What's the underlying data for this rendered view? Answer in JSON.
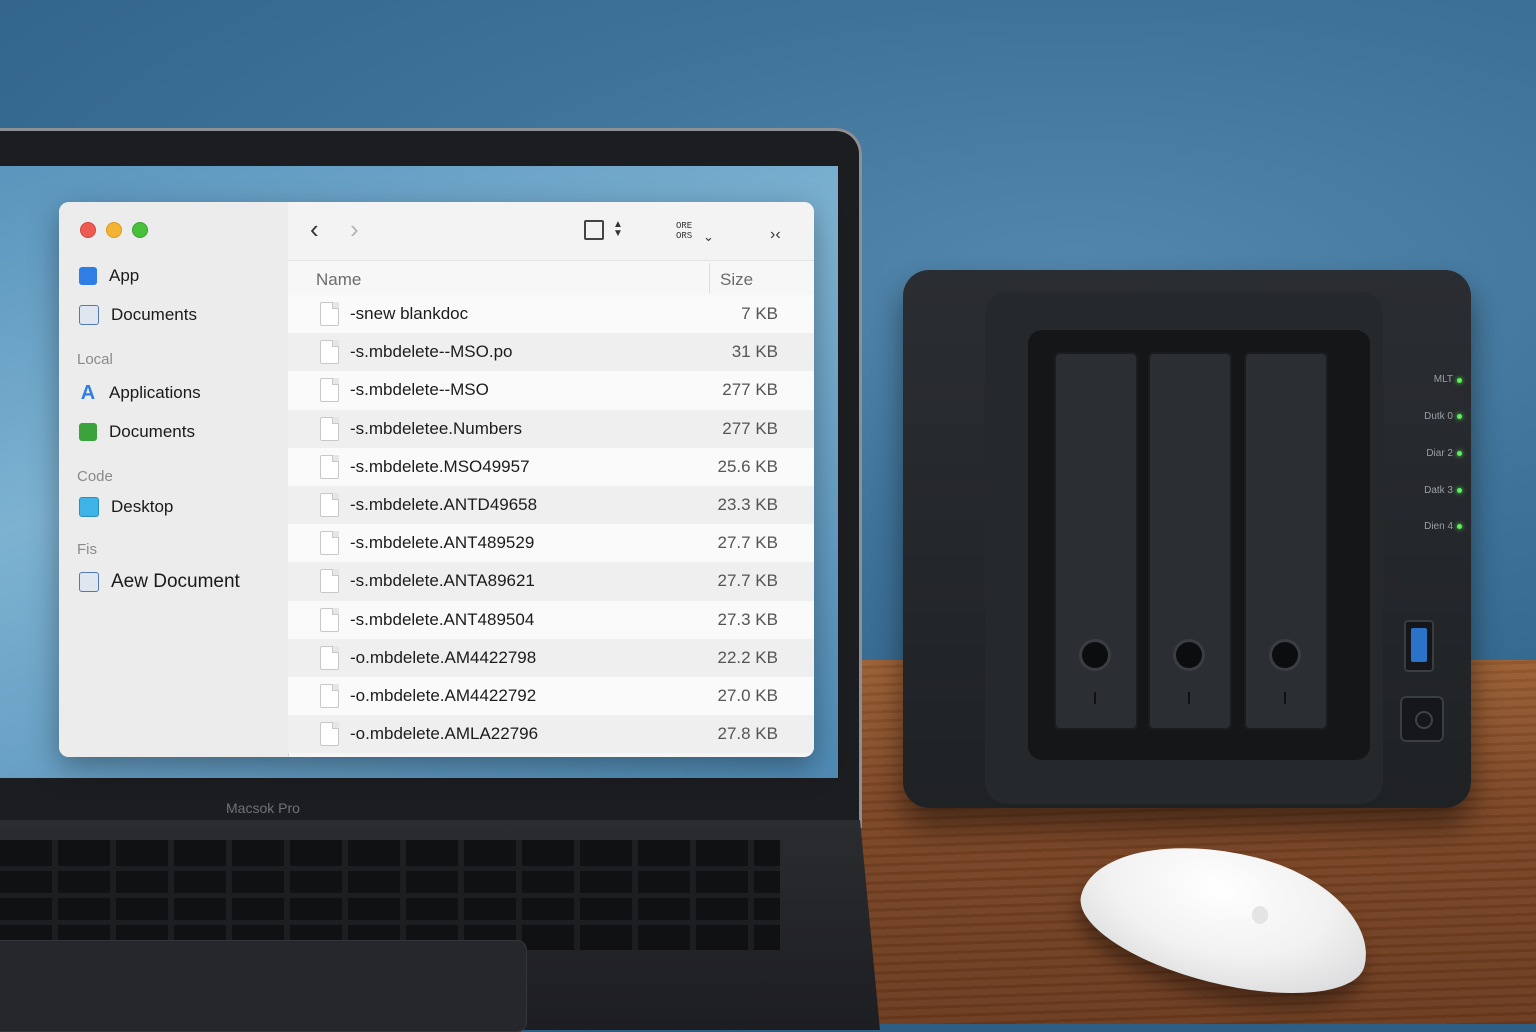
{
  "laptop": {
    "bezel_label": "Macsok Pro"
  },
  "finder": {
    "sidebar": {
      "favorites": [
        {
          "label": "App",
          "icon": "app-store-icon"
        },
        {
          "label": "Documents",
          "icon": "document-icon"
        }
      ],
      "sections": [
        {
          "title": "Local",
          "items": [
            {
              "label": "Applications",
              "icon": "applications-icon"
            },
            {
              "label": "Documents",
              "icon": "folder-green-icon"
            }
          ]
        },
        {
          "title": "Code",
          "items": [
            {
              "label": "Desktop",
              "icon": "desktop-icon"
            }
          ]
        },
        {
          "title": "Fis",
          "items": [
            {
              "label": "Aew Document",
              "icon": "document-icon"
            }
          ]
        }
      ]
    },
    "toolbar": {
      "back": "‹",
      "forward": "›",
      "view_icon": "sidebar-toggle-icon",
      "group_label_top": "ORE",
      "group_label_bottom": "ORS",
      "more": "›‹"
    },
    "columns": {
      "name": "Name",
      "size": "Size"
    },
    "files": [
      {
        "name": "-snew blankdoc",
        "size": "7 KB"
      },
      {
        "name": "-s.mbdelete--MSO.po",
        "size": "31 KB"
      },
      {
        "name": "-s.mbdelete--MSO",
        "size": "277 KB"
      },
      {
        "name": "-s.mbdeletee.Numbers",
        "size": "277 KB"
      },
      {
        "name": "-s.mbdelete.MSO49957",
        "size": "25.6 KB"
      },
      {
        "name": "-s.mbdelete.ANTD49658",
        "size": "23.3 KB"
      },
      {
        "name": "-s.mbdelete.ANT489529",
        "size": "27.7 KB"
      },
      {
        "name": "-s.mbdelete.ANTA89621",
        "size": "27.7 KB"
      },
      {
        "name": "-s.mbdelete.ANT489504",
        "size": "27.3 KB"
      },
      {
        "name": "-o.mbdelete.AM4422798",
        "size": "22.2 KB"
      },
      {
        "name": "-o.mbdelete.AM4422792",
        "size": "27.0 KB"
      },
      {
        "name": "-o.mbdelete.AMLA22796",
        "size": "27.8 KB"
      }
    ]
  },
  "nas": {
    "leds": [
      "MLT",
      "Dutk 0",
      "Diar 2",
      "Datk 3",
      "Dien 4"
    ],
    "led_color": "#5df05a"
  }
}
